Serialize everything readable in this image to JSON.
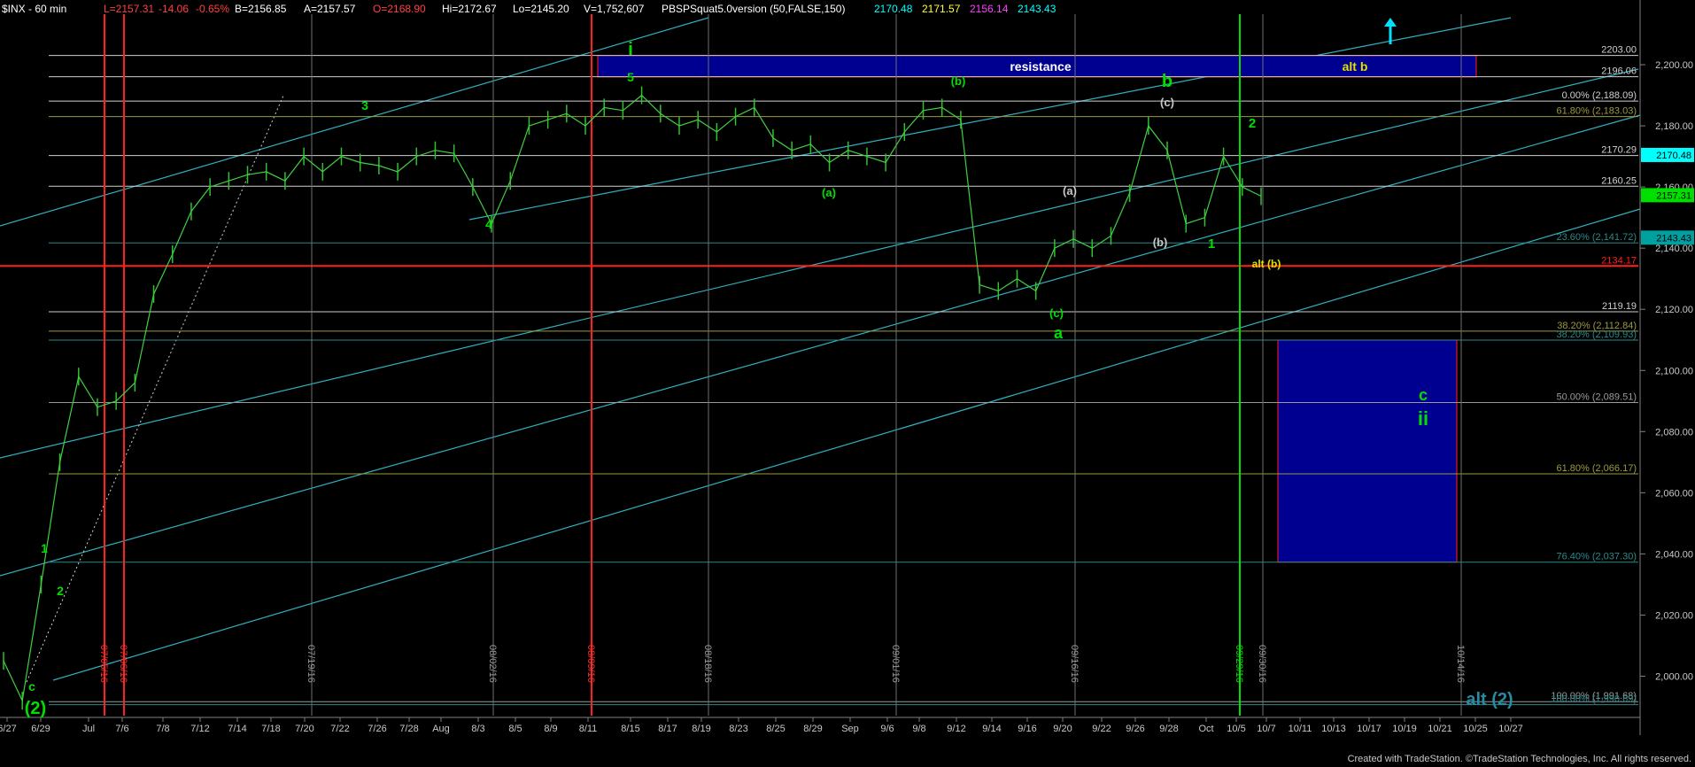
{
  "header": {
    "symbol": "$INX - 60 min",
    "fields": [
      {
        "text": "L=2157.31",
        "color": "#ff4040"
      },
      {
        "text": "-14.06",
        "color": "#ff4040"
      },
      {
        "text": "-0.65%",
        "color": "#ff4040"
      },
      {
        "text": "B=2156.85",
        "color": "#ffffff"
      },
      {
        "text": "A=2157.57",
        "color": "#ffffff"
      },
      {
        "text": "O=2168.90",
        "color": "#ff4040"
      },
      {
        "text": "Hi=2172.67",
        "color": "#ffffff"
      },
      {
        "text": "Lo=2145.20",
        "color": "#ffffff"
      },
      {
        "text": "V=1,752,607",
        "color": "#ffffff"
      },
      {
        "text": "PBSPSquat5.0version (50,FALSE,150)",
        "color": "#ffffff"
      },
      {
        "text": "2170.48",
        "color": "#00ffff"
      },
      {
        "text": "2171.57",
        "color": "#ffff40"
      },
      {
        "text": "2156.14",
        "color": "#ff40ff"
      },
      {
        "text": "2143.43",
        "color": "#00ffff"
      }
    ]
  },
  "footer": {
    "credit": "Created with TradeStation. ©TradeStation Technologies, Inc. All rights reserved."
  },
  "chart_data": {
    "type": "line",
    "title": "$INX - 60 min",
    "ylim": [
      1990,
      2220
    ],
    "y_ticks": [
      "2,200.00",
      "2,180.00",
      "2,160.00",
      "2,140.00",
      "2,120.00",
      "2,100.00",
      "2,080.00",
      "2,060.00",
      "2,040.00",
      "2,020.00",
      "2,000.00"
    ],
    "y_tick_values": [
      2200,
      2180,
      2160,
      2140,
      2120,
      2100,
      2080,
      2060,
      2040,
      2020,
      2000
    ],
    "x_ticks": [
      "6/27",
      "6/29",
      "Jul",
      "7/6",
      "7/8",
      "7/12",
      "7/14",
      "7/18",
      "7/20",
      "7/22",
      "7/26",
      "7/28",
      "Aug",
      "8/3",
      "8/5",
      "8/9",
      "8/11",
      "8/15",
      "8/17",
      "8/19",
      "8/23",
      "8/25",
      "8/29",
      "Sep",
      "9/6",
      "9/8",
      "9/12",
      "9/14",
      "9/16",
      "9/20",
      "9/22",
      "9/26",
      "9/28",
      "Oct",
      "10/5",
      "10/7",
      "10/11",
      "10/13",
      "10/17",
      "10/19",
      "10/21",
      "10/25",
      "10/27"
    ],
    "price_series": {
      "name": "$INX",
      "x": [
        "6/27",
        "6/28",
        "6/29",
        "6/30",
        "7/1",
        "7/5",
        "7/6",
        "7/7",
        "7/8",
        "7/11",
        "7/12",
        "7/13",
        "7/14",
        "7/15",
        "7/18",
        "7/19",
        "7/20",
        "7/21",
        "7/22",
        "7/25",
        "7/26",
        "7/27",
        "7/28",
        "7/29",
        "8/1",
        "8/2",
        "8/3",
        "8/4",
        "8/5",
        "8/8",
        "8/9",
        "8/10",
        "8/11",
        "8/12",
        "8/15",
        "8/16",
        "8/17",
        "8/18",
        "8/19",
        "8/22",
        "8/23",
        "8/24",
        "8/25",
        "8/26",
        "8/29",
        "8/30",
        "8/31",
        "9/1",
        "9/2",
        "9/6",
        "9/7",
        "9/8",
        "9/9",
        "9/12",
        "9/13",
        "9/14",
        "9/15",
        "9/16",
        "9/19",
        "9/20",
        "9/21",
        "9/22",
        "9/23",
        "9/26",
        "9/27",
        "9/28",
        "9/29",
        "9/30"
      ],
      "y": [
        2005,
        1992,
        2030,
        2070,
        2098,
        2088,
        2090,
        2096,
        2125,
        2138,
        2152,
        2160,
        2162,
        2164,
        2165,
        2162,
        2170,
        2165,
        2170,
        2168,
        2167,
        2165,
        2170,
        2172,
        2171,
        2160,
        2148,
        2162,
        2180,
        2182,
        2184,
        2180,
        2186,
        2185,
        2190,
        2184,
        2180,
        2182,
        2178,
        2183,
        2186,
        2176,
        2172,
        2174,
        2168,
        2172,
        2170,
        2168,
        2178,
        2185,
        2186,
        2182,
        2128,
        2126,
        2130,
        2126,
        2140,
        2143,
        2140,
        2144,
        2158,
        2180,
        2172,
        2148,
        2150,
        2170,
        2160,
        2157
      ]
    },
    "levels": [
      {
        "value": 2203.0,
        "label": "2203.00",
        "color": "#d0d0d0"
      },
      {
        "value": 2196.06,
        "label": "2196.06",
        "color": "#d0d0d0"
      },
      {
        "value": 2188.09,
        "label": "0.00% (2,188.09)",
        "color": "#d0d0d0"
      },
      {
        "value": 2183.03,
        "label": "61.80% (2,183.03)",
        "color": "#9a9a40"
      },
      {
        "value": 2170.29,
        "label": "2170.29",
        "color": "#d0d0d0"
      },
      {
        "value": 2160.25,
        "label": "2160.25",
        "color": "#d0d0d0"
      },
      {
        "value": 2141.72,
        "label": "23.60% (2,141.72)",
        "color": "#2a8a8a"
      },
      {
        "value": 2134.17,
        "label": "2134.17",
        "color": "#ff2020"
      },
      {
        "value": 2119.19,
        "label": "2119.19",
        "color": "#d0d0d0"
      },
      {
        "value": 2112.84,
        "label": "38.20% (2,112.84)",
        "color": "#9a9a40"
      },
      {
        "value": 2109.93,
        "label": "38.20% (2,109.93)",
        "color": "#2a8a8a"
      },
      {
        "value": 2089.51,
        "label": "50.00% (2,089.51)",
        "color": "#9a9a9a"
      },
      {
        "value": 2066.17,
        "label": "61.80% (2,066.17)",
        "color": "#9a9a40"
      },
      {
        "value": 2037.3,
        "label": "76.40% (2,037.30)",
        "color": "#2a8a8a"
      },
      {
        "value": 1991.68,
        "label": "100.00% (1,991.68)",
        "color": "#9a9a9a"
      },
      {
        "value": 1990.69,
        "label": "100.00% (1,990.69)",
        "color": "#2a8a8a"
      }
    ],
    "price_badges": [
      {
        "value": 2170.48,
        "label": "2170.48",
        "bg": "#00ffff",
        "fg": "#000000"
      },
      {
        "value": 2157.31,
        "label": "2157.31",
        "bg": "#00e000",
        "fg": "#000000"
      },
      {
        "value": 2143.43,
        "label": "2143.43",
        "bg": "#00a0a0",
        "fg": "#000000"
      }
    ],
    "resistance_zone": {
      "label": "resistance",
      "y_low": 2196,
      "y_high": 2203
    },
    "target_zone": {
      "y_low": 2037.3,
      "y_high": 2109.93
    },
    "vertical_date_labels": [
      {
        "text": "07/05/16",
        "color": "#ff3030"
      },
      {
        "text": "07/06/16",
        "color": "#ff3030"
      },
      {
        "text": "07/19/16",
        "color": "#9a9a9a"
      },
      {
        "text": "08/02/16",
        "color": "#9a9a9a"
      },
      {
        "text": "08/09/16",
        "color": "#ff3030"
      },
      {
        "text": "08/18/16",
        "color": "#9a9a9a"
      },
      {
        "text": "09/01/16",
        "color": "#9a9a9a"
      },
      {
        "text": "09/16/16",
        "color": "#9a9a9a"
      },
      {
        "text": "09/29/16",
        "color": "#00e000"
      },
      {
        "text": "09/30/16",
        "color": "#9a9a9a"
      },
      {
        "text": "10/14/16",
        "color": "#9a9a9a"
      }
    ],
    "wave_labels": [
      {
        "text": "c",
        "color": "#00e000"
      },
      {
        "text": "(2)",
        "color": "#00e000"
      },
      {
        "text": "1",
        "color": "#00e000"
      },
      {
        "text": "2",
        "color": "#00e000"
      },
      {
        "text": "3",
        "color": "#00e000"
      },
      {
        "text": "4",
        "color": "#00e000"
      },
      {
        "text": "5",
        "color": "#00e000"
      },
      {
        "text": "i",
        "color": "#00e000"
      },
      {
        "text": "(a)",
        "color": "#00e000"
      },
      {
        "text": "(b)",
        "color": "#00e000"
      },
      {
        "text": "(a)",
        "color": "#c8c8c8"
      },
      {
        "text": "(b)",
        "color": "#c8c8c8"
      },
      {
        "text": "(c)",
        "color": "#00e000"
      },
      {
        "text": "a",
        "color": "#00e000"
      },
      {
        "text": "(c)",
        "color": "#c8c8c8"
      },
      {
        "text": "b",
        "color": "#00e000"
      },
      {
        "text": "1",
        "color": "#00e000"
      },
      {
        "text": "2",
        "color": "#00e000"
      },
      {
        "text": "alt (b)",
        "color": "#e0e000"
      },
      {
        "text": "alt b",
        "color": "#e0e000"
      },
      {
        "text": "c",
        "color": "#00e000"
      },
      {
        "text": "ii",
        "color": "#00e000"
      },
      {
        "text": "alt (2)",
        "color": "#2a8aa0"
      }
    ]
  }
}
